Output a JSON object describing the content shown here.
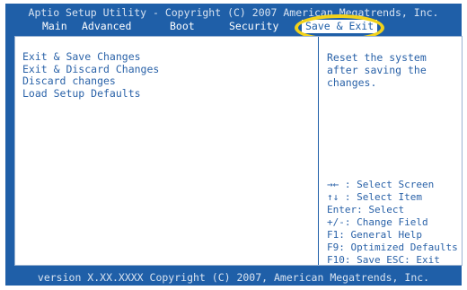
{
  "header": {
    "title": "Aptio Setup Utility - Copyright (C) 2007 American Megatrends, Inc."
  },
  "tabs": [
    {
      "label": "Main"
    },
    {
      "label": "Advanced"
    },
    {
      "label": "Boot"
    },
    {
      "label": "Security"
    },
    {
      "label": "Save & Exit",
      "active": true
    }
  ],
  "menu": {
    "items": [
      {
        "label": "Exit & Save Changes"
      },
      {
        "label": "Exit & Discard Changes"
      },
      {
        "label": "Discard changes"
      },
      {
        "label": "Load Setup Defaults"
      }
    ]
  },
  "help": {
    "text": "Reset the system after saving the changes."
  },
  "keys": [
    {
      "text": "→← : Select Screen"
    },
    {
      "text": "↑↓ : Select Item"
    },
    {
      "text": "Enter: Select"
    },
    {
      "text": "+/-: Change Field"
    },
    {
      "text": "F1:  General Help"
    },
    {
      "text": "F9:  Optimized Defaults"
    },
    {
      "text": "F10: Save ESC: Exit"
    }
  ],
  "footer": {
    "text": "version X.XX.XXXX Copyright (C) 2007, American Megatrends, Inc."
  },
  "colors": {
    "background": "#1f5fa8",
    "text_light": "#d8e3f1",
    "text_blue": "#2a62a8",
    "highlight": "#f2d21a"
  }
}
